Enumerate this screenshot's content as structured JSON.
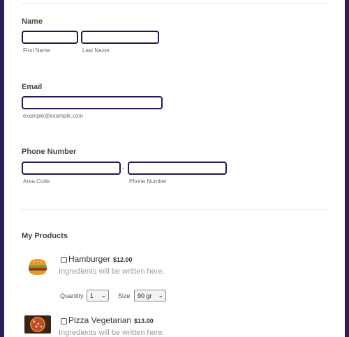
{
  "form": {
    "name": {
      "label": "Name",
      "first_sublabel": "First Name",
      "last_sublabel": "Last Name",
      "first_value": "",
      "last_value": ""
    },
    "email": {
      "label": "Email",
      "sublabel": "example@example.com",
      "value": ""
    },
    "phone": {
      "label": "Phone Number",
      "separator": "-",
      "area_sublabel": "Area Code",
      "number_sublabel": "Phone Number",
      "area_value": "",
      "number_value": ""
    }
  },
  "products": {
    "title": "My Products",
    "items": [
      {
        "name": "Hamburger",
        "price": "$12.00",
        "description": "Ingredients will be written here.",
        "image_icon": "hamburger-icon",
        "checked": false,
        "quantity_label": "Quantity",
        "quantity_value": "1",
        "size_label": "Size",
        "size_value": "90 gr"
      },
      {
        "name": "Pizza Vegetarian",
        "price": "$13.00",
        "description": "Ingredients will be written here.",
        "image_icon": "pizza-icon",
        "checked": false
      }
    ]
  },
  "colors": {
    "frame": "#2e1f5c",
    "input_border": "#1f1a4f"
  }
}
